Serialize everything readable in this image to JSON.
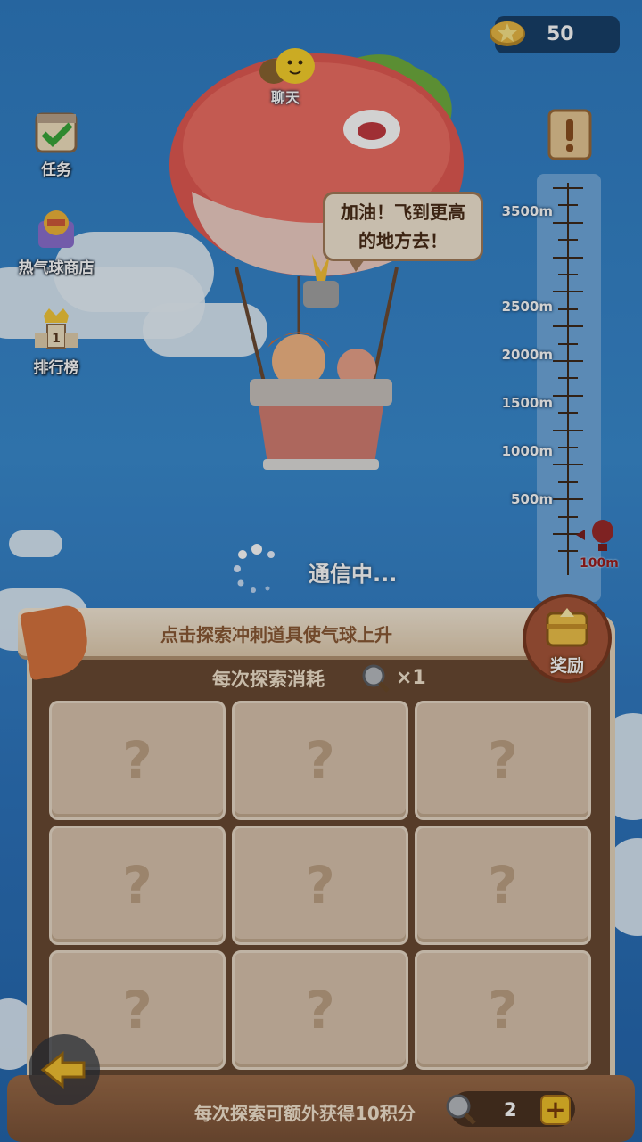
{
  "currency": {
    "icon": "star-coin-icon",
    "value": "50"
  },
  "sidebar": {
    "items": [
      {
        "label": "任务",
        "icon": "task-calendar-icon"
      },
      {
        "label": "热气球商店",
        "icon": "balloon-shop-icon"
      },
      {
        "label": "排行榜",
        "icon": "ranking-crown-icon"
      }
    ]
  },
  "chat": {
    "label": "聊天",
    "icon": "chat-bubble-icon"
  },
  "speech": {
    "line1": "加油！飞到更高",
    "line2": "的地方去！"
  },
  "altitude": {
    "ticks": [
      "3500m",
      "2500m",
      "2000m",
      "1500m",
      "1000m",
      "500m"
    ],
    "current": "100m",
    "progress_fraction": 0.03
  },
  "loading": {
    "text": "通信中..."
  },
  "board": {
    "banner": "点击探索冲刺道具使气球上升",
    "reward_label": "奖励",
    "cost_label": "每次探索消耗",
    "cost_multiplier": "×1",
    "cells": [
      "?",
      "?",
      "?",
      "?",
      "?",
      "?",
      "?",
      "?",
      "?"
    ]
  },
  "footer": {
    "text": "每次探索可额外获得10积分",
    "count": "2",
    "plus": "+"
  },
  "colors": {
    "sky": "#2f7cc3",
    "board": "#6a4a33",
    "cell": "#d9c4ae",
    "accent": "#f0c12a"
  }
}
